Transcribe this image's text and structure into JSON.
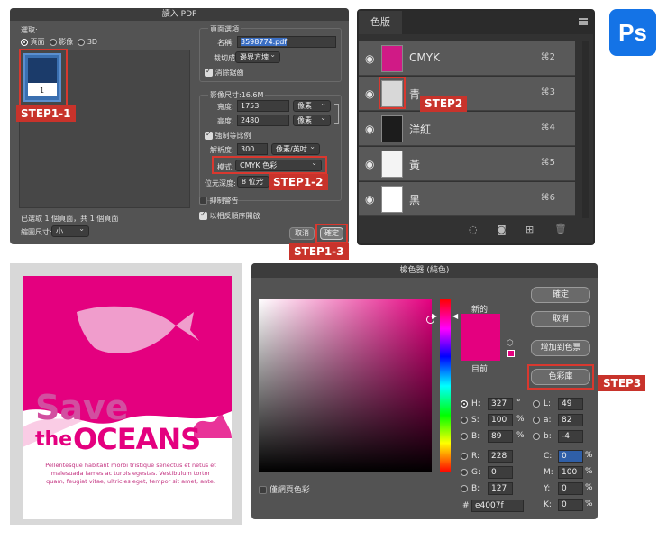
{
  "pdf_dialog": {
    "title": "讀入 PDF",
    "select_label": "選取:",
    "radio_options": [
      "頁面",
      "影像",
      "3D"
    ],
    "page_number": "1",
    "status": "已選取 1 個頁面，共 1 個頁面",
    "thumb_size_label": "縮圖尺寸:",
    "thumb_size_value": "小",
    "page_options_header": "頁面選項",
    "name_label": "名稱:",
    "name_value": "3598774.pdf",
    "crop_label": "裁切成:",
    "crop_value": "邊界方塊",
    "antialias_label": "消除鋸齒",
    "image_size_label": "影像尺寸:16.6M",
    "width_label": "寬度:",
    "width_value": "1753",
    "width_unit": "像素",
    "height_label": "高度:",
    "height_value": "2480",
    "height_unit": "像素",
    "constrain_label": "強制等比例",
    "resolution_label": "解析度:",
    "resolution_value": "300",
    "resolution_unit": "像素/英吋",
    "mode_label": "模式:",
    "mode_value": "CMYK 色彩",
    "depth_label": "位元深度:",
    "depth_value": "8 位元",
    "suppress_label": "抑制警告",
    "reverse_label": "以相反順序開啟",
    "cancel_label": "取消",
    "ok_label": "確定"
  },
  "channels_panel": {
    "title": "色版",
    "channels": [
      {
        "name": "CMYK",
        "shortcut": "⌘2"
      },
      {
        "name": "青",
        "shortcut": "⌘3"
      },
      {
        "name": "洋紅",
        "shortcut": "⌘4"
      },
      {
        "name": "黃",
        "shortcut": "⌘5"
      },
      {
        "name": "黑",
        "shortcut": "⌘6"
      }
    ]
  },
  "app_logo": "Ps",
  "poster": {
    "line1": "Save",
    "line2a": "the",
    "line2b": "OCEANS",
    "body": "Pellentesque habitant morbi tristique senectus et netus et malesuada fames ac turpis egestas. Vestibulum tortor quam, feugiat vitae, ultricies eget, tempor sit amet, ante.",
    "colors": {
      "magenta": "#e4007f",
      "pink_text": "#d24fa0"
    }
  },
  "color_picker": {
    "title": "檢色器 (純色)",
    "new_label": "新的",
    "current_label": "目前",
    "ok_label": "確定",
    "cancel_label": "取消",
    "add_swatch_label": "增加到色票",
    "libraries_label": "色彩庫",
    "h_label": "H:",
    "h_value": "327",
    "h_unit": "°",
    "s_label": "S:",
    "s_value": "100",
    "s_unit": "%",
    "b_label": "B:",
    "b_value": "89",
    "b_unit": "%",
    "r_label": "R:",
    "r_value": "228",
    "g_label": "G:",
    "g_value": "0",
    "bb_label": "B:",
    "bb_value": "127",
    "l_label": "L:",
    "l_value": "49",
    "a_label": "a:",
    "a_value": "82",
    "lb_label": "b:",
    "lb_value": "-4",
    "c_label": "C:",
    "c_value": "0",
    "m_label": "M:",
    "m_value": "100",
    "y_label": "Y:",
    "y_value": "0",
    "k_label": "K:",
    "k_value": "0",
    "pct": "%",
    "hex_label": "#",
    "hex_value": "e4007f",
    "web_only_label": "僅網頁色彩",
    "color": "#e4007f"
  },
  "steps": {
    "s11": "STEP1-1",
    "s12": "STEP1-2",
    "s13": "STEP1-3",
    "s2": "STEP2",
    "s3": "STEP3"
  }
}
